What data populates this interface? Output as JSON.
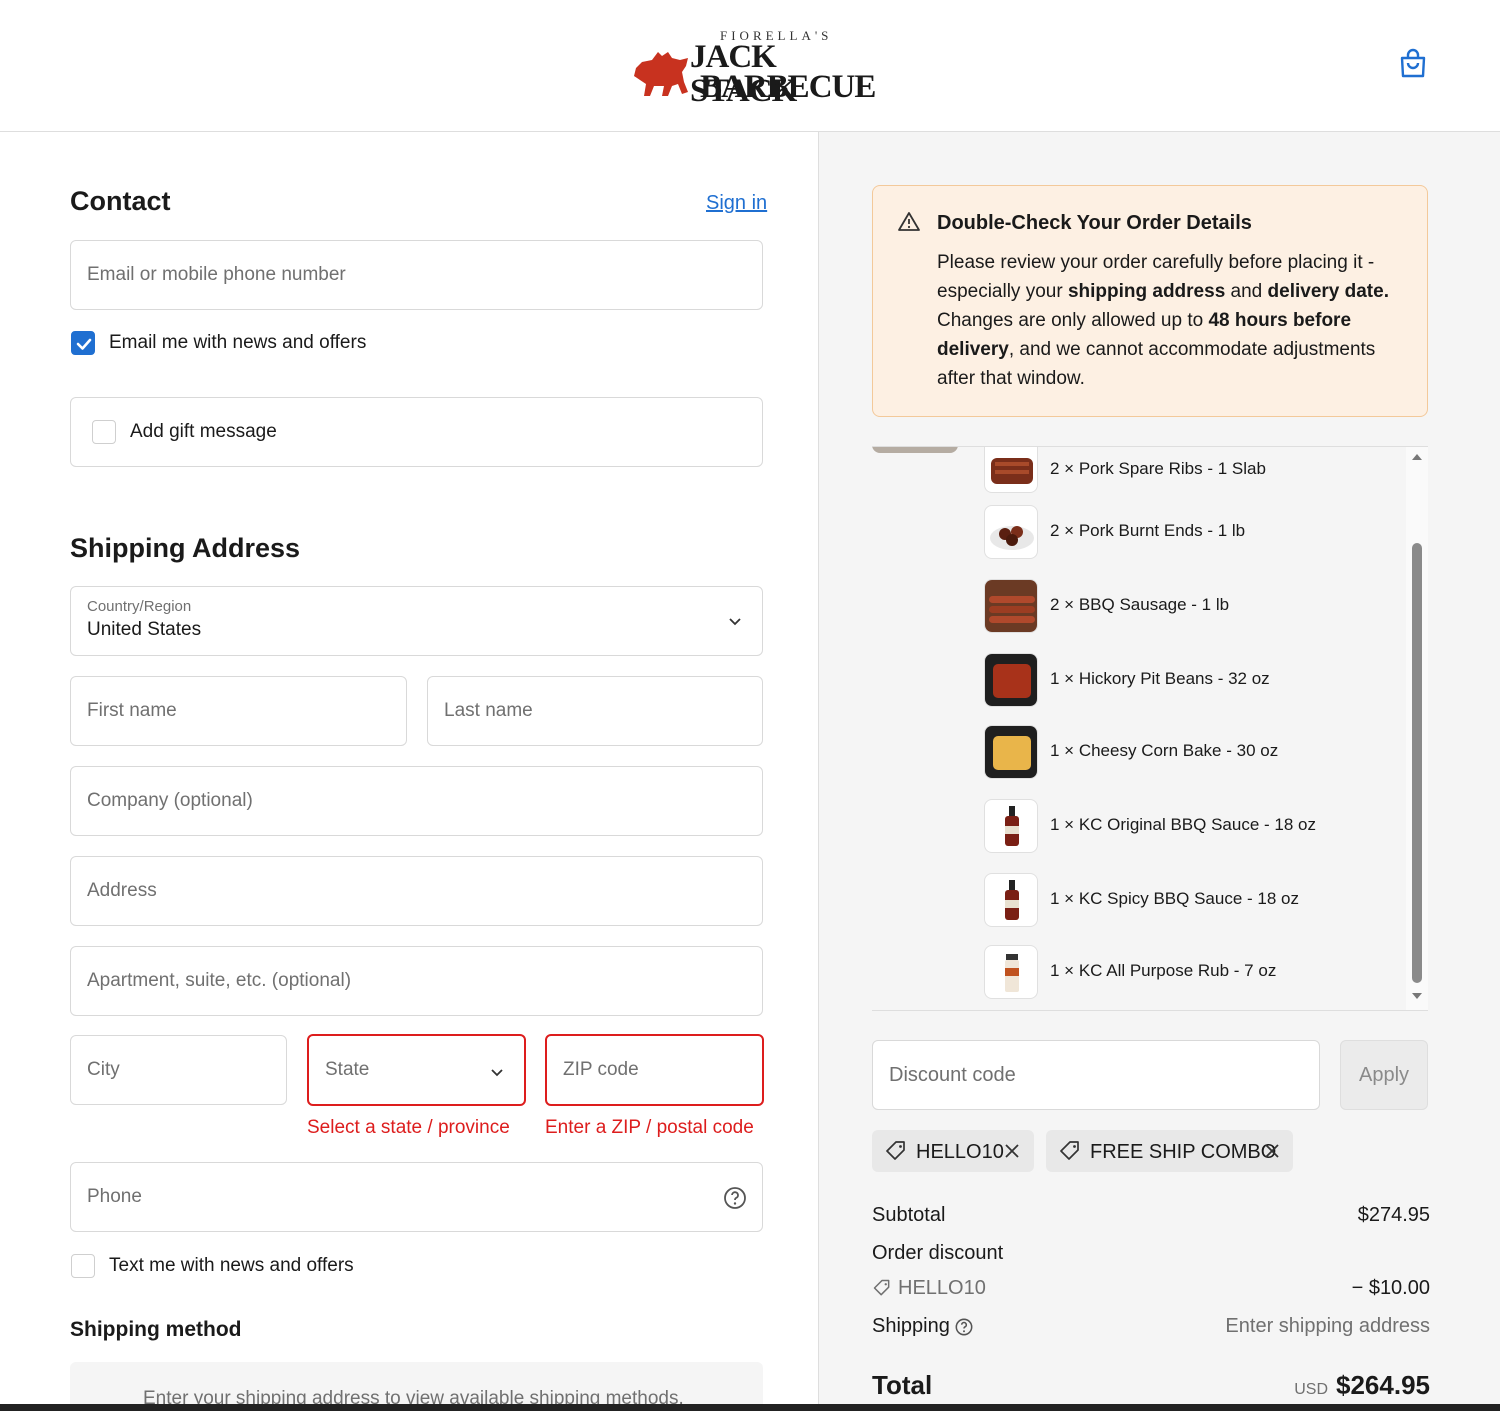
{
  "header": {
    "logo_pre": "FIORELLA'S",
    "logo_line1": "JACK STACK",
    "logo_line2": "BARBECUE"
  },
  "contact": {
    "title": "Contact",
    "signin": "Sign in",
    "email_placeholder": "Email or mobile phone number",
    "news_label": "Email me with news and offers",
    "news_checked": true,
    "gift_label": "Add gift message"
  },
  "shipping": {
    "title": "Shipping Address",
    "country_label": "Country/Region",
    "country_value": "United States",
    "first_name": "First name",
    "last_name": "Last name",
    "company": "Company (optional)",
    "address": "Address",
    "apartment": "Apartment, suite, etc. (optional)",
    "city": "City",
    "state": "State",
    "zip": "ZIP code",
    "state_error": "Select a state / province",
    "zip_error": "Enter a ZIP / postal code",
    "phone": "Phone",
    "text_label": "Text me with news and offers",
    "method_title": "Shipping method",
    "method_note": "Enter your shipping address to view available shipping methods."
  },
  "notice": {
    "title": "Double-Check Your Order Details",
    "p1": "Please review your order carefully before placing it - especially your ",
    "b1": "shipping address",
    "p2": " and ",
    "b2": "delivery date.",
    "p3": " Changes are only allowed up to ",
    "b3": "48 hours before delivery",
    "p4": ", and we cannot accommodate adjustments after that window."
  },
  "items": [
    {
      "text": "2 × Pork Spare Ribs - 1 Slab",
      "thumb": "ribs"
    },
    {
      "text": "2 × Pork Burnt Ends - 1 lb",
      "thumb": "burnt-ends"
    },
    {
      "text": "2 × BBQ Sausage - 1 lb",
      "thumb": "sausage"
    },
    {
      "text": "1 × Hickory Pit Beans - 32 oz",
      "thumb": "beans"
    },
    {
      "text": "1 × Cheesy Corn Bake - 30 oz",
      "thumb": "corn-bake"
    },
    {
      "text": "1 × KC Original BBQ Sauce - 18 oz",
      "thumb": "sauce-bottle"
    },
    {
      "text": "1 × KC Spicy BBQ Sauce - 18 oz",
      "thumb": "sauce-bottle"
    },
    {
      "text": "1 × KC All Purpose Rub - 7 oz",
      "thumb": "rub-jar"
    }
  ],
  "discount": {
    "placeholder": "Discount code",
    "apply": "Apply",
    "tags": [
      "HELLO10",
      "FREE SHIP COMBO"
    ]
  },
  "summary": {
    "subtotal_label": "Subtotal",
    "subtotal_value": "$274.95",
    "order_discount_label": "Order discount",
    "discount_code": "HELLO10",
    "discount_value": "− $10.00",
    "shipping_label": "Shipping",
    "shipping_value": "Enter shipping address",
    "total_label": "Total",
    "currency": "USD",
    "total_value": "$264.95"
  },
  "colors": {
    "accent": "#1f6fd1",
    "error": "#dd1d1d",
    "notice_bg": "#fdf0e3"
  }
}
